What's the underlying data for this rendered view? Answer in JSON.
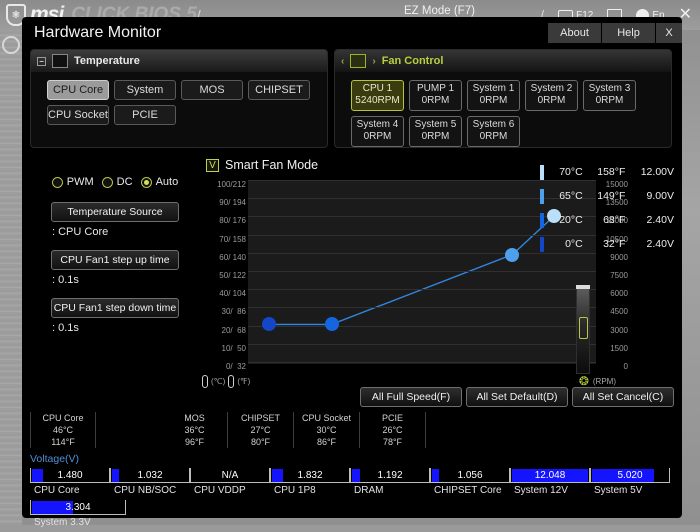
{
  "bios": {
    "brand_logo": "msi",
    "brand_word": "CLICK BIOS 5",
    "ez_mode": "EZ Mode (F7)",
    "screenshot_key": "F12",
    "language": "En"
  },
  "dialog": {
    "title": "Hardware Monitor",
    "buttons": {
      "about": "About",
      "help": "Help",
      "close": "X"
    }
  },
  "temperature_panel": {
    "header": "Temperature",
    "sources": [
      {
        "label": "CPU Core",
        "active": true
      },
      {
        "label": "System",
        "active": false
      },
      {
        "label": "MOS",
        "active": false
      },
      {
        "label": "CHIPSET",
        "active": false
      },
      {
        "label": "CPU Socket",
        "active": false
      },
      {
        "label": "PCIE",
        "active": false
      }
    ]
  },
  "fan_panel": {
    "header": "Fan Control",
    "fans": [
      {
        "name": "CPU 1",
        "rpm": "5240RPM",
        "active": true
      },
      {
        "name": "PUMP 1",
        "rpm": "0RPM",
        "active": false
      },
      {
        "name": "System 1",
        "rpm": "0RPM",
        "active": false
      },
      {
        "name": "System 2",
        "rpm": "0RPM",
        "active": false
      },
      {
        "name": "System 3",
        "rpm": "0RPM",
        "active": false
      },
      {
        "name": "System 4",
        "rpm": "0RPM",
        "active": false
      },
      {
        "name": "System 5",
        "rpm": "0RPM",
        "active": false
      },
      {
        "name": "System 6",
        "rpm": "0RPM",
        "active": false
      }
    ]
  },
  "controls": {
    "modes": [
      {
        "label": "PWM",
        "selected": false
      },
      {
        "label": "DC",
        "selected": false
      },
      {
        "label": "Auto",
        "selected": true
      }
    ],
    "fields": [
      {
        "label": "Temperature Source",
        "value": ": CPU Core"
      },
      {
        "label": "CPU Fan1 step up time",
        "value": ": 0.1s"
      },
      {
        "label": "CPU Fan1 step down time",
        "value": ": 0.1s"
      }
    ]
  },
  "smart_fan": {
    "label": "Smart Fan Mode",
    "checked": true,
    "check_glyph": "V"
  },
  "chart_data": {
    "type": "line",
    "title": "Smart Fan Mode",
    "xlabel": "",
    "ylabel": "",
    "grid": true,
    "left_axis": {
      "label": "(°C) / (°F)",
      "ticks": [
        "100/212",
        "90/ 194",
        "80/ 176",
        "70/ 158",
        "60/ 140",
        "50/ 122",
        "40/ 104",
        "30/  86",
        "20/  68",
        "10/  50",
        "0/  32"
      ],
      "celsius_range": [
        0,
        100
      ]
    },
    "right_axis": {
      "label": "(RPM)",
      "ticks": [
        "15000",
        "13500",
        "12000",
        "10500",
        "9000",
        "7500",
        "6000",
        "4500",
        "3000",
        "1500",
        "0"
      ],
      "range": [
        0,
        15000
      ]
    },
    "points": [
      {
        "temp_c": 0,
        "temp_f": 32,
        "volts": "2.40V",
        "x_pct": 6,
        "y_pct": 21.5,
        "color": "#1347c8"
      },
      {
        "temp_c": 20,
        "temp_f": 68,
        "volts": "2.40V",
        "x_pct": 24,
        "y_pct": 21.5,
        "color": "#1565e0"
      },
      {
        "temp_c": 65,
        "temp_f": 149,
        "volts": "9.00V",
        "x_pct": 76,
        "y_pct": 59.5,
        "color": "#4fa0ec"
      },
      {
        "temp_c": 70,
        "temp_f": 158,
        "volts": "12.00V",
        "x_pct": 88,
        "y_pct": 80.5,
        "color": "#badff8"
      }
    ],
    "gauge_rpm": 5240
  },
  "legend": [
    {
      "color": "#badff8",
      "c": "70°C",
      "f": "158°F",
      "v": "12.00V"
    },
    {
      "color": "#4fa0ec",
      "c": "65°C",
      "f": "149°F",
      "v": "9.00V"
    },
    {
      "color": "#1565e0",
      "c": "20°C",
      "f": "68°F",
      "v": "2.40V"
    },
    {
      "color": "#1347c8",
      "c": "0°C",
      "f": "32°F",
      "v": "2.40V"
    }
  ],
  "actions": [
    {
      "label": "All Full Speed(F)"
    },
    {
      "label": "All Set Default(D)"
    },
    {
      "label": "All Set Cancel(C)"
    }
  ],
  "temp_readouts": [
    {
      "name": "CPU Core",
      "c": "46°C",
      "f": "114°F"
    },
    {
      "name": "",
      "c": "",
      "f": ""
    },
    {
      "name": "MOS",
      "c": "36°C",
      "f": "96°F"
    },
    {
      "name": "CHIPSET",
      "c": "27°C",
      "f": "80°F"
    },
    {
      "name": "CPU Socket",
      "c": "30°C",
      "f": "86°F"
    },
    {
      "name": "PCIE",
      "c": "26°C",
      "f": "78°F"
    }
  ],
  "voltage": {
    "title": "Voltage(V)",
    "items": [
      {
        "name": "CPU Core",
        "value": "1.480",
        "fill_pct": 14
      },
      {
        "name": "CPU NB/SOC",
        "value": "1.032",
        "fill_pct": 9
      },
      {
        "name": "CPU VDDP",
        "value": "N/A",
        "fill_pct": 0
      },
      {
        "name": "CPU 1P8",
        "value": "1.832",
        "fill_pct": 14
      },
      {
        "name": "DRAM",
        "value": "1.192",
        "fill_pct": 10
      },
      {
        "name": "CHIPSET Core",
        "value": "1.056",
        "fill_pct": 9
      },
      {
        "name": "System 12V",
        "value": "12.048",
        "fill_pct": 97
      },
      {
        "name": "System 5V",
        "value": "5.020",
        "fill_pct": 80
      }
    ],
    "items_row2": [
      {
        "name": "System 3.3V",
        "value": "3.304",
        "fill_pct": 44
      }
    ]
  }
}
